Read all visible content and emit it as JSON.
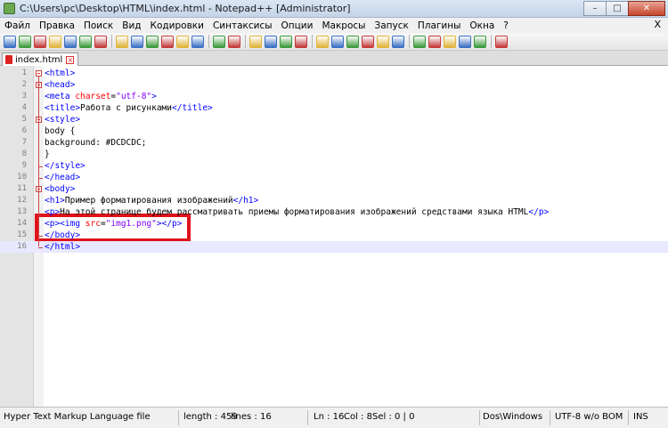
{
  "window": {
    "title": "C:\\Users\\pc\\Desktop\\HTML\\index.html - Notepad++ [Administrator]",
    "minimize": "–",
    "maximize": "□",
    "close": "✕"
  },
  "menu": {
    "items": [
      "Файл",
      "Правка",
      "Поиск",
      "Вид",
      "Кодировки",
      "Синтаксисы",
      "Опции",
      "Макросы",
      "Запуск",
      "Плагины",
      "Окна",
      "?"
    ],
    "close_label": "X"
  },
  "toolbar": {
    "icons": [
      "new-file-icon",
      "open-file-icon",
      "save-icon",
      "save-all-icon",
      "close-icon",
      "close-all-icon",
      "print-icon",
      "cut-icon",
      "copy-icon",
      "paste-icon",
      "undo-icon",
      "redo-icon",
      "find-icon",
      "replace-icon",
      "zoom-in-icon",
      "zoom-out-icon",
      "sync-v-icon",
      "sync-h-icon",
      "word-wrap-icon",
      "show-all-chars-icon",
      "indent-guide-icon",
      "udl-icon",
      "doc-map-icon",
      "function-list-icon",
      "record-macro-icon",
      "stop-record-icon",
      "play-macro-icon",
      "play-multi-icon",
      "save-macro-icon",
      "spellcheck-icon",
      "misc-icon"
    ],
    "colors": {
      "icon_blue": "#3a6fc4",
      "icon_green": "#3b9a3b",
      "icon_red": "#c43a3a",
      "icon_yellow": "#e0b43a"
    }
  },
  "tabs": [
    {
      "label": "index.html",
      "active": true
    }
  ],
  "editor": {
    "lines": [
      {
        "num": "1",
        "segments": [
          [
            "t",
            "<html>"
          ]
        ]
      },
      {
        "num": "2",
        "segments": [
          [
            "t",
            "<head>"
          ]
        ]
      },
      {
        "num": "3",
        "segments": [
          [
            "t",
            "<meta "
          ],
          [
            "a",
            "charset"
          ],
          [
            "x",
            "="
          ],
          [
            "v",
            "\"utf-8\""
          ],
          [
            "t",
            ">"
          ]
        ]
      },
      {
        "num": "4",
        "segments": [
          [
            "t",
            "<title>"
          ],
          [
            "x",
            "Работа с рисунками"
          ],
          [
            "t",
            "</title>"
          ]
        ]
      },
      {
        "num": "5",
        "segments": [
          [
            "t",
            "<style>"
          ]
        ]
      },
      {
        "num": "6",
        "segments": [
          [
            "x",
            "body {"
          ]
        ]
      },
      {
        "num": "7",
        "segments": [
          [
            "x",
            "background: #DCDCDC;"
          ]
        ]
      },
      {
        "num": "8",
        "segments": [
          [
            "x",
            "}"
          ]
        ]
      },
      {
        "num": "9",
        "segments": [
          [
            "t",
            "</style>"
          ]
        ]
      },
      {
        "num": "10",
        "segments": [
          [
            "t",
            "</head>"
          ]
        ]
      },
      {
        "num": "11",
        "segments": [
          [
            "t",
            "<body>"
          ]
        ]
      },
      {
        "num": "12",
        "segments": [
          [
            "t",
            "<h1>"
          ],
          [
            "x",
            "Пример форматирования изображений"
          ],
          [
            "t",
            "</h1>"
          ]
        ]
      },
      {
        "num": "13",
        "segments": [
          [
            "t",
            "<p>"
          ],
          [
            "x",
            "На этой странице будем рассматривать приемы форматирования изображений средствами языка HTML"
          ],
          [
            "t",
            "</p>"
          ]
        ]
      },
      {
        "num": "14",
        "segments": [
          [
            "t",
            "<p><img "
          ],
          [
            "a",
            "src"
          ],
          [
            "x",
            "="
          ],
          [
            "v",
            "\"img1.png\""
          ],
          [
            "t",
            "></p>"
          ]
        ]
      },
      {
        "num": "15",
        "segments": [
          [
            "t",
            "</body>"
          ]
        ]
      },
      {
        "num": "16",
        "segments": [
          [
            "t",
            "</html>"
          ]
        ]
      }
    ],
    "current_line": "16",
    "colors": {
      "tag": "#0000ff",
      "attribute": "#ff0000",
      "value": "#8000ff",
      "highlight_box": "#e0121a",
      "current_line_bg": "#e8e8ff"
    }
  },
  "status": {
    "file_type": "Hyper Text Markup Language file",
    "length": "length : 459",
    "lines": "lines : 16",
    "ln": "Ln : 16",
    "col": "Col : 8",
    "sel": "Sel : 0 | 0",
    "eol": "Dos\\Windows",
    "encoding": "UTF-8 w/o BOM",
    "mode": "INS"
  }
}
